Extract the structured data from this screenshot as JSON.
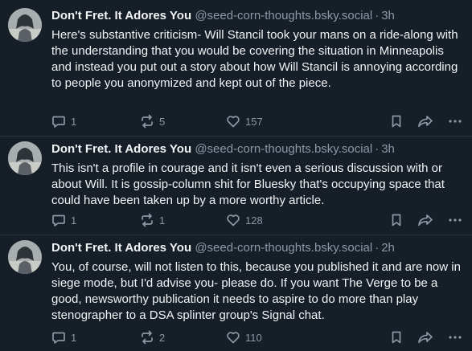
{
  "posts": [
    {
      "author_name": "Don't Fret. It Adores You",
      "handle": "@seed-corn-thoughts.bsky.social",
      "separator": "·",
      "time": "3h",
      "text": "Here's substantive criticism- Will Stancil took your mans on a ride-along with the understanding that you would be covering the situation in Minneapolis and instead you put out a story about how Will Stancil is annoying according to people you anonymized and kept out of the piece.",
      "replies": "1",
      "reposts": "5",
      "likes": "157"
    },
    {
      "author_name": "Don't Fret. It Adores You",
      "handle": "@seed-corn-thoughts.bsky.social",
      "separator": "·",
      "time": "3h",
      "text": "This isn't a profile in courage and it isn't even a serious discussion with or about Will.  It is gossip-column shit for Bluesky that's occupying space that could have been taken up by a more worthy article.",
      "replies": "1",
      "reposts": "1",
      "likes": "128"
    },
    {
      "author_name": "Don't Fret. It Adores You",
      "handle": "@seed-corn-thoughts.bsky.social",
      "separator": "·",
      "time": "2h",
      "text": "You, of course, will not listen to this, because you published it and are now in siege mode, but I'd advise you- please do.  If you want The Verge to be a good, newsworthy publication it needs to aspire to do more than play stenographer to a DSA splinter group's Signal chat.",
      "replies": "1",
      "reposts": "2",
      "likes": "110"
    }
  ],
  "icons": {
    "reply": "speech-bubble-icon",
    "repost": "repost-arrows-icon",
    "like": "heart-icon",
    "bookmark": "bookmark-icon",
    "share": "share-arrow-icon",
    "more": "ellipsis-icon"
  },
  "colors": {
    "background": "#161e27",
    "text": "#f1f3f5",
    "muted": "#8d98a5",
    "divider": "#2b3540"
  }
}
